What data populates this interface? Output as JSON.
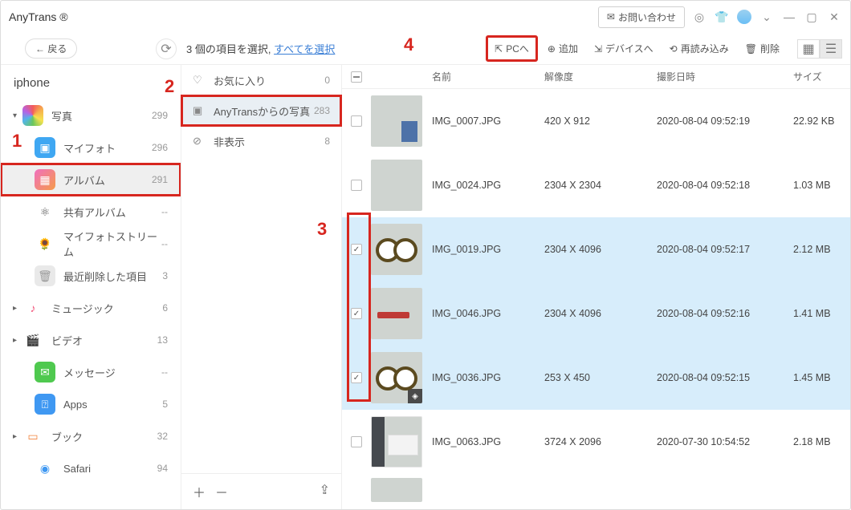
{
  "app": {
    "name": "AnyTrans ®",
    "contact_label": "お問い合わせ"
  },
  "toolbar": {
    "back_label": "戻る",
    "selection_prefix": "3 個の項目を選択, ",
    "select_all_label": "すべてを選択",
    "actions": {
      "to_pc": "PCへ",
      "add": "追加",
      "to_device": "デバイスへ",
      "reload": "再読み込み",
      "delete": "削除"
    }
  },
  "device": {
    "name": "iphone"
  },
  "sidebar": [
    {
      "label": "写真",
      "count": "299",
      "exp": "▾",
      "icon_class": "ic-photos"
    },
    {
      "label": "マイフォト",
      "count": "296",
      "sub": true,
      "icon_class": "ic-myphoto",
      "glyph": "▣"
    },
    {
      "label": "アルバム",
      "count": "291",
      "sub": true,
      "active": true,
      "red": true,
      "icon_class": "ic-album",
      "glyph": "▦"
    },
    {
      "label": "共有アルバム",
      "count": "--",
      "sub": true,
      "icon_class": "ic-shared",
      "glyph": "⚛"
    },
    {
      "label": "マイフォトストリーム",
      "count": "--",
      "sub": true,
      "icon_class": "ic-stream",
      "glyph": "🌻"
    },
    {
      "label": "最近削除した項目",
      "count": "3",
      "sub": true,
      "icon_class": "ic-trash",
      "glyph": "🗑"
    },
    {
      "label": "ミュージック",
      "count": "6",
      "exp": "▸",
      "icon_class": "ic-music",
      "glyph": "♪"
    },
    {
      "label": "ビデオ",
      "count": "13",
      "exp": "▸",
      "icon_class": "ic-video",
      "glyph": "🎬"
    },
    {
      "label": "メッセージ",
      "count": "--",
      "sub": true,
      "icon_class": "ic-msg",
      "glyph": "✉"
    },
    {
      "label": "Apps",
      "count": "5",
      "sub": true,
      "icon_class": "ic-apps",
      "glyph": "⍰"
    },
    {
      "label": "ブック",
      "count": "32",
      "exp": "▸",
      "icon_class": "ic-book",
      "glyph": "▭"
    },
    {
      "label": "Safari",
      "count": "94",
      "sub": true,
      "icon_class": "ic-safari",
      "glyph": "◉"
    }
  ],
  "mid": [
    {
      "icon": "♡",
      "label": "お気に入り",
      "count": "0"
    },
    {
      "icon": "▣",
      "label": "AnyTransからの写真",
      "count": "283",
      "active": true,
      "red": true
    },
    {
      "icon": "⊘",
      "label": "非表示",
      "count": "8"
    }
  ],
  "columns": {
    "name": "名前",
    "resolution": "解像度",
    "date": "撮影日時",
    "size": "サイズ"
  },
  "rows": [
    {
      "name": "IMG_0007.JPG",
      "res": "420 X 912",
      "date": "2020-08-04 09:52:19",
      "size": "22.92 KB",
      "checked": false,
      "thumb": "th-0007"
    },
    {
      "name": "IMG_0024.JPG",
      "res": "2304 X 2304",
      "date": "2020-08-04 09:52:18",
      "size": "1.03 MB",
      "checked": false,
      "thumb": "th-0024"
    },
    {
      "name": "IMG_0019.JPG",
      "res": "2304 X 4096",
      "date": "2020-08-04 09:52:17",
      "size": "2.12 MB",
      "checked": true,
      "thumb": "th-0019"
    },
    {
      "name": "IMG_0046.JPG",
      "res": "2304 X 4096",
      "date": "2020-08-04 09:52:16",
      "size": "1.41 MB",
      "checked": true,
      "thumb": "th-0046"
    },
    {
      "name": "IMG_0036.JPG",
      "res": "253 X 450",
      "date": "2020-08-04 09:52:15",
      "size": "1.45 MB",
      "checked": true,
      "thumb": "th-0036"
    },
    {
      "name": "IMG_0063.JPG",
      "res": "3724 X 2096",
      "date": "2020-07-30 10:54:52",
      "size": "2.18 MB",
      "checked": false,
      "thumb": "th-0063"
    }
  ],
  "annotations": {
    "a1": "1",
    "a2": "2",
    "a3": "3",
    "a4": "4"
  }
}
